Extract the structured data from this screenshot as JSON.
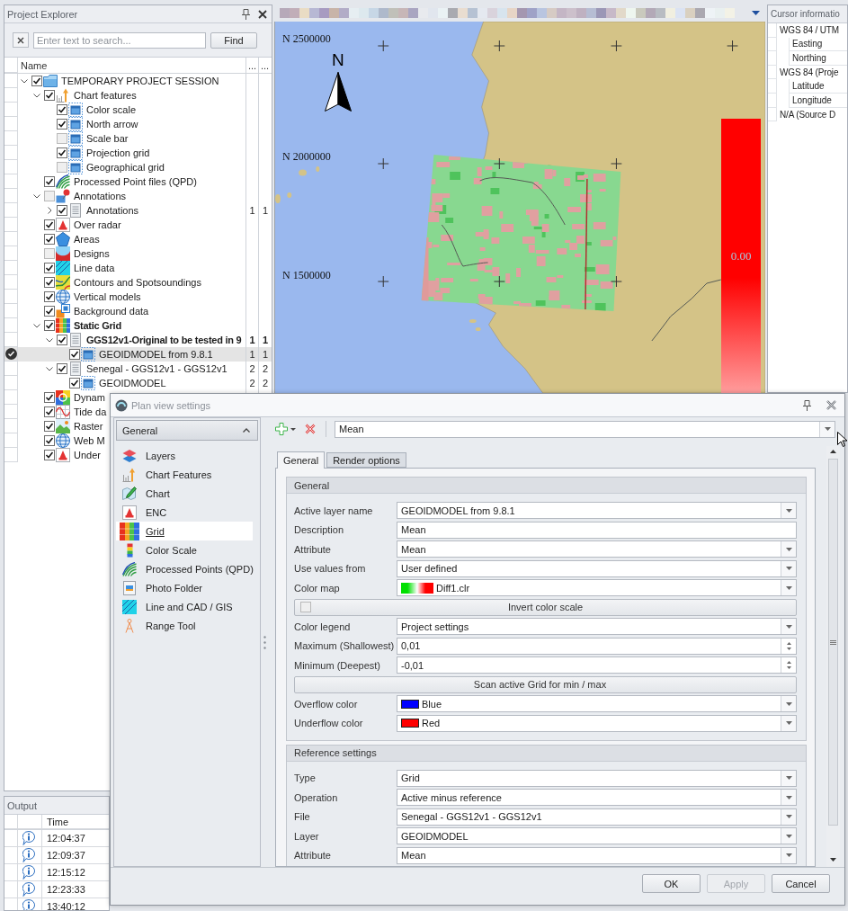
{
  "explorer": {
    "title": "Project Explorer",
    "search": {
      "placeholder": "Enter text to search...",
      "button": "Find"
    },
    "columns": [
      "Name",
      "...",
      "..."
    ],
    "tree": [
      {
        "label": "TEMPORARY PROJECT SESSION",
        "kind": "session",
        "checked": true,
        "active": false,
        "selected": false,
        "expanded": true,
        "children": [
          {
            "label": "Chart features",
            "kind": "features",
            "checked": true,
            "active": false,
            "selected": false,
            "expanded": true,
            "children": [
              {
                "label": "Color scale",
                "kind": "feature",
                "checked": true,
                "active": false,
                "selected": false
              },
              {
                "label": "North arrow",
                "kind": "feature",
                "checked": true,
                "active": false,
                "selected": false
              },
              {
                "label": "Scale bar",
                "kind": "feature",
                "checked": false,
                "active": false,
                "selected": false
              },
              {
                "label": "Projection grid",
                "kind": "feature",
                "checked": true,
                "active": false,
                "selected": false
              },
              {
                "label": "Geographical grid",
                "kind": "feature",
                "checked": false,
                "active": false,
                "selected": false
              }
            ]
          },
          {
            "label": "Processed Point files (QPD)",
            "kind": "points",
            "checked": true,
            "active": false,
            "selected": false
          },
          {
            "label": "Annotations",
            "kind": "annotations",
            "checked": false,
            "active": false,
            "selected": false,
            "expanded": true,
            "children": [
              {
                "label": "Annotations",
                "kind": "dataset",
                "checked": true,
                "active": false,
                "selected": false,
                "expanded": false,
                "values": [
                  "1",
                  "1"
                ]
              }
            ]
          },
          {
            "label": "Over radar",
            "kind": "enc",
            "checked": true,
            "active": false,
            "selected": false
          },
          {
            "label": "Areas",
            "kind": "areas",
            "checked": true,
            "active": false,
            "selected": false
          },
          {
            "label": "Designs",
            "kind": "designs",
            "checked": false,
            "active": false,
            "selected": false
          },
          {
            "label": "Line data",
            "kind": "lines",
            "checked": true,
            "active": false,
            "selected": false
          },
          {
            "label": "Contours and Spotsoundings",
            "kind": "contours",
            "checked": true,
            "active": false,
            "selected": false
          },
          {
            "label": "Vertical models",
            "kind": "models",
            "checked": true,
            "active": false,
            "selected": false
          },
          {
            "label": "Background data",
            "kind": "background",
            "checked": true,
            "active": false,
            "selected": false
          },
          {
            "label": "Static Grid",
            "kind": "grid",
            "checked": true,
            "active": true,
            "selected": false,
            "expanded": true,
            "children": [
              {
                "label": "GGS12v1-Original to be tested in 9",
                "kind": "dataset",
                "checked": true,
                "active": true,
                "selected": false,
                "expanded": true,
                "values": [
                  "1",
                  "1"
                ],
                "children": [
                  {
                    "label": "GEOIDMODEL from 9.8.1",
                    "kind": "layer",
                    "checked": true,
                    "active": false,
                    "selected": true,
                    "values": [
                      "1",
                      "1"
                    ]
                  }
                ]
              },
              {
                "label": "Senegal - GGS12v1 - GGS12v1",
                "kind": "dataset",
                "checked": true,
                "active": false,
                "selected": false,
                "expanded": true,
                "values": [
                  "2",
                  "2"
                ],
                "children": [
                  {
                    "label": "GEOIDMODEL",
                    "kind": "layer",
                    "checked": true,
                    "active": false,
                    "selected": false,
                    "values": [
                      "2",
                      "2"
                    ]
                  }
                ]
              }
            ]
          },
          {
            "label": "Dynam",
            "kind": "dynamic",
            "checked": true,
            "active": false,
            "selected": false
          },
          {
            "label": "Tide da",
            "kind": "tide",
            "checked": true,
            "active": false,
            "selected": false
          },
          {
            "label": "Raster",
            "kind": "raster",
            "checked": true,
            "active": false,
            "selected": false
          },
          {
            "label": "Web M",
            "kind": "web",
            "checked": true,
            "active": false,
            "selected": false
          },
          {
            "label": "Under",
            "kind": "enc",
            "checked": true,
            "active": false,
            "selected": false
          }
        ]
      }
    ]
  },
  "output": {
    "title": "Output",
    "columns": [
      "Time"
    ],
    "rows": [
      {
        "time": "12:04:37"
      },
      {
        "time": "12:09:37"
      },
      {
        "time": "12:15:12"
      },
      {
        "time": "12:23:33"
      },
      {
        "time": "13:40:12"
      }
    ]
  },
  "map": {
    "northing_labels": [
      "N 2500000",
      "N 2000000",
      "N 1500000"
    ],
    "north_label": "N",
    "scale_label": "0.00"
  },
  "cursor_info": {
    "title": "Cursor informatio",
    "groups": [
      {
        "label": "WGS 84 / UTM",
        "children": [
          {
            "label": "Easting"
          },
          {
            "label": "Northing"
          }
        ]
      },
      {
        "label": "WGS 84 (Proje",
        "children": [
          {
            "label": "Latitude"
          },
          {
            "label": "Longitude"
          }
        ]
      },
      {
        "label": "N/A (Source D"
      }
    ]
  },
  "dialog": {
    "title": "Plan view settings",
    "nav": {
      "header": "General",
      "expanded": true,
      "items": [
        {
          "label": "Layers",
          "kind": "layers",
          "selected": false
        },
        {
          "label": "Chart Features",
          "kind": "features",
          "selected": false
        },
        {
          "label": "Chart",
          "kind": "chart",
          "selected": false
        },
        {
          "label": "ENC",
          "kind": "enc",
          "selected": false
        },
        {
          "label": "Grid",
          "kind": "grid",
          "selected": true
        },
        {
          "label": "Color Scale",
          "kind": "scale",
          "selected": false
        },
        {
          "label": "Processed Points (QPD)",
          "kind": "points",
          "selected": false
        },
        {
          "label": "Photo Folder",
          "kind": "photo",
          "selected": false
        },
        {
          "label": "Line and CAD / GIS",
          "kind": "lines",
          "selected": false
        },
        {
          "label": "Range Tool",
          "kind": "range",
          "selected": false
        }
      ]
    },
    "preset": "Mean",
    "tabs": [
      {
        "label": "General",
        "selected": true
      },
      {
        "label": "Render options",
        "selected": false
      }
    ],
    "groups": [
      {
        "title": "General",
        "rows": [
          {
            "kind": "combo",
            "label": "Active layer name",
            "value": "GEOIDMODEL from 9.8.1"
          },
          {
            "kind": "text",
            "label": "Description",
            "value": "Mean"
          },
          {
            "kind": "combo",
            "label": "Attribute",
            "value": "Mean"
          },
          {
            "kind": "combo",
            "label": "Use values from",
            "value": "User defined"
          },
          {
            "kind": "gradient",
            "label": "Color map",
            "value": "Diff1.clr"
          },
          {
            "kind": "toggle",
            "label": "Invert color scale",
            "checked": false
          },
          {
            "kind": "combo",
            "label": "Color legend",
            "value": "Project settings"
          },
          {
            "kind": "spin",
            "label": "Maximum (Shallowest)",
            "value": "0,01"
          },
          {
            "kind": "spin",
            "label": "Minimum (Deepest)",
            "value": "-0,01"
          },
          {
            "kind": "button",
            "label": "Scan active Grid for min / max"
          },
          {
            "kind": "swatch",
            "label": "Overflow color",
            "value": "Blue",
            "color": "#0000ff"
          },
          {
            "kind": "swatch",
            "label": "Underflow color",
            "value": "Red",
            "color": "#ff0000"
          }
        ]
      },
      {
        "title": "Reference settings",
        "rows": [
          {
            "kind": "combo",
            "label": "Type",
            "value": "Grid"
          },
          {
            "kind": "combo",
            "label": "Operation",
            "value": "Active minus reference"
          },
          {
            "kind": "combo",
            "label": "File",
            "value": "Senegal - GGS12v1 - GGS12v1"
          },
          {
            "kind": "combo",
            "label": "Layer",
            "value": "GEOIDMODEL"
          },
          {
            "kind": "combo",
            "label": "Attribute",
            "value": "Mean"
          }
        ]
      }
    ],
    "buttons": [
      {
        "label": "OK",
        "disabled": false
      },
      {
        "label": "Apply",
        "disabled": true
      },
      {
        "label": "Cancel",
        "disabled": false
      }
    ]
  }
}
